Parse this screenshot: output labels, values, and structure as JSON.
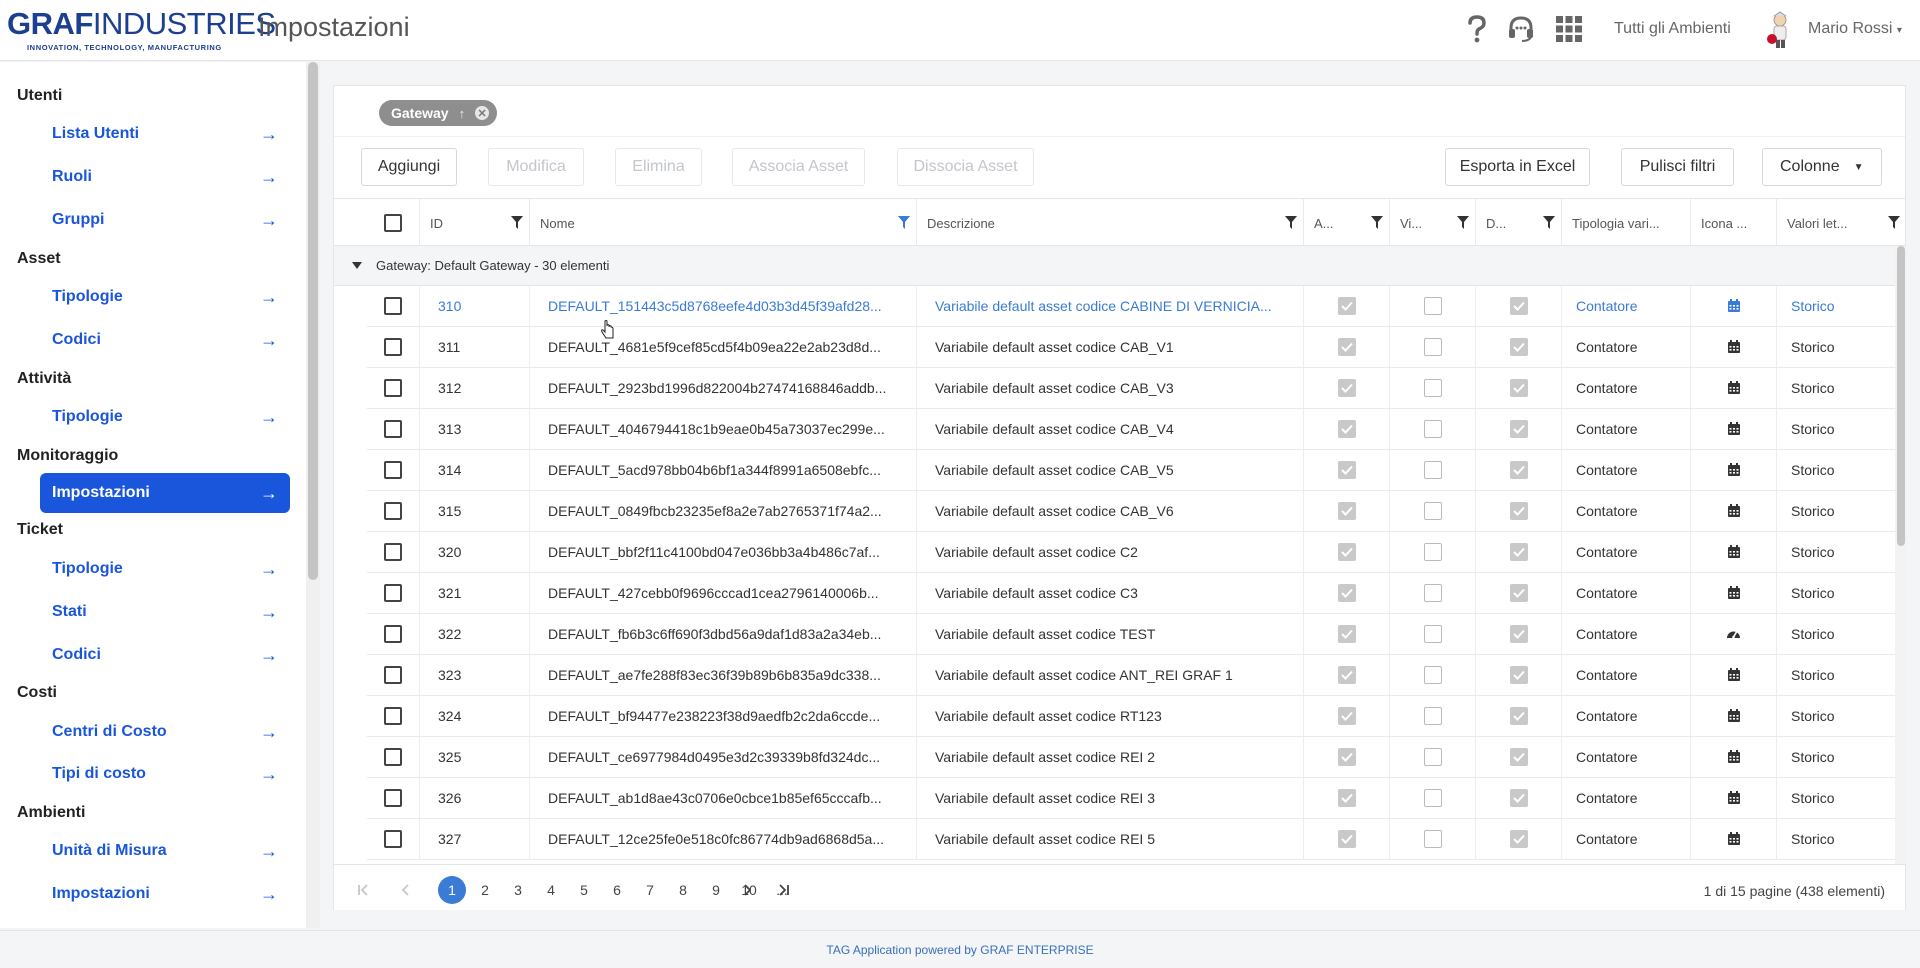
{
  "header": {
    "logo_text_bold": "GRAF",
    "logo_text_light": "INDUSTRIES",
    "logo_tagline": "INNOVATION, TECHNOLOGY, MANUFACTURING",
    "page_title": "Impostazioni",
    "help_icon": "help-icon",
    "support_icon": "headset-icon",
    "apps_icon": "grid-icon",
    "environments_label": "Tutti gli Ambienti",
    "user_name": "Mario Rossi"
  },
  "sidebar": {
    "sections": [
      {
        "title": "Utenti",
        "items": [
          "Lista Utenti",
          "Ruoli",
          "Gruppi"
        ]
      },
      {
        "title": "Asset",
        "items": [
          "Tipologie",
          "Codici"
        ]
      },
      {
        "title": "Attività",
        "items": [
          "Tipologie"
        ]
      },
      {
        "title": "Monitoraggio",
        "items": [
          "Impostazioni"
        ]
      },
      {
        "title": "Ticket",
        "items": [
          "Tipologie",
          "Stati",
          "Codici"
        ]
      },
      {
        "title": "Costi",
        "items": [
          "Centri di Costo",
          "Tipi di costo"
        ]
      },
      {
        "title": "Ambienti",
        "items": [
          "Unità di Misura",
          "Impostazioni"
        ]
      }
    ],
    "active_item": "Impostazioni"
  },
  "grid": {
    "group_chip": "Gateway",
    "toolbar": {
      "add": "Aggiungi",
      "edit": "Modifica",
      "delete": "Elimina",
      "assoc": "Associa Asset",
      "dissoc": "Dissocia Asset",
      "export": "Esporta in Excel",
      "clear_filters": "Pulisci filtri",
      "columns": "Colonne"
    },
    "columns": [
      "ID",
      "Nome",
      "Descrizione",
      "A...",
      "Vi...",
      "D...",
      "Tipologia vari...",
      "Icona ...",
      "Valori let..."
    ],
    "group_label": "Gateway: Default Gateway - 30 elementi",
    "rows": [
      {
        "id": "310",
        "nome": "DEFAULT_151443c5d8768eefe4d03b3d45f39afd28...",
        "descrizione": "Variabile default asset codice CABINE DI VERNICIA...",
        "a": true,
        "vi": false,
        "d": true,
        "tipologia": "Contatore",
        "icona": "calendar-icon",
        "valori": "Storico",
        "highlight": true
      },
      {
        "id": "311",
        "nome": "DEFAULT_4681e5f9cef85cd5f4b09ea22e2ab23d8d...",
        "descrizione": "Variabile default asset codice CAB_V1",
        "a": true,
        "vi": false,
        "d": true,
        "tipologia": "Contatore",
        "icona": "calendar-icon",
        "valori": "Storico"
      },
      {
        "id": "312",
        "nome": "DEFAULT_2923bd1996d822004b27474168846addb...",
        "descrizione": "Variabile default asset codice CAB_V3",
        "a": true,
        "vi": false,
        "d": true,
        "tipologia": "Contatore",
        "icona": "calendar-icon",
        "valori": "Storico"
      },
      {
        "id": "313",
        "nome": "DEFAULT_4046794418c1b9eae0b45a73037ec299e...",
        "descrizione": "Variabile default asset codice CAB_V4",
        "a": true,
        "vi": false,
        "d": true,
        "tipologia": "Contatore",
        "icona": "calendar-icon",
        "valori": "Storico"
      },
      {
        "id": "314",
        "nome": "DEFAULT_5acd978bb04b6bf1a344f8991a6508ebfc...",
        "descrizione": "Variabile default asset codice CAB_V5",
        "a": true,
        "vi": false,
        "d": true,
        "tipologia": "Contatore",
        "icona": "calendar-icon",
        "valori": "Storico"
      },
      {
        "id": "315",
        "nome": "DEFAULT_0849fbcb23235ef8a2e7ab2765371f74a2...",
        "descrizione": "Variabile default asset codice CAB_V6",
        "a": true,
        "vi": false,
        "d": true,
        "tipologia": "Contatore",
        "icona": "calendar-icon",
        "valori": "Storico"
      },
      {
        "id": "320",
        "nome": "DEFAULT_bbf2f11c4100bd047e036bb3a4b486c7af...",
        "descrizione": "Variabile default asset codice C2",
        "a": true,
        "vi": false,
        "d": true,
        "tipologia": "Contatore",
        "icona": "calendar-icon",
        "valori": "Storico"
      },
      {
        "id": "321",
        "nome": "DEFAULT_427cebb0f9696cccad1cea2796140006b...",
        "descrizione": "Variabile default asset codice C3",
        "a": true,
        "vi": false,
        "d": true,
        "tipologia": "Contatore",
        "icona": "calendar-icon",
        "valori": "Storico"
      },
      {
        "id": "322",
        "nome": "DEFAULT_fb6b3c6ff690f3dbd56a9daf1d83a2a34eb...",
        "descrizione": "Variabile default asset codice TEST",
        "a": true,
        "vi": false,
        "d": true,
        "tipologia": "Contatore",
        "icona": "gauge-icon",
        "valori": "Storico"
      },
      {
        "id": "323",
        "nome": "DEFAULT_ae7fe288f83ec36f39b89b6b835a9dc338...",
        "descrizione": "Variabile default asset codice ANT_REI GRAF 1",
        "a": true,
        "vi": false,
        "d": true,
        "tipologia": "Contatore",
        "icona": "calendar-icon",
        "valori": "Storico"
      },
      {
        "id": "324",
        "nome": "DEFAULT_bf94477e238223f38d9aedfb2c2da6ccde...",
        "descrizione": "Variabile default asset codice RT123",
        "a": true,
        "vi": false,
        "d": true,
        "tipologia": "Contatore",
        "icona": "calendar-icon",
        "valori": "Storico"
      },
      {
        "id": "325",
        "nome": "DEFAULT_ce6977984d0495e3d2c39339b8fd324dc...",
        "descrizione": "Variabile default asset codice REI 2",
        "a": true,
        "vi": false,
        "d": true,
        "tipologia": "Contatore",
        "icona": "calendar-icon",
        "valori": "Storico"
      },
      {
        "id": "326",
        "nome": "DEFAULT_ab1d8ae43c0706e0cbce1b85ef65cccafb...",
        "descrizione": "Variabile default asset codice REI 3",
        "a": true,
        "vi": false,
        "d": true,
        "tipologia": "Contatore",
        "icona": "calendar-icon",
        "valori": "Storico"
      },
      {
        "id": "327",
        "nome": "DEFAULT_12ce25fe0e518c0fc86774db9ad6868d5a...",
        "descrizione": "Variabile default asset codice REI 5",
        "a": true,
        "vi": false,
        "d": true,
        "tipologia": "Contatore",
        "icona": "calendar-icon",
        "valori": "Storico"
      }
    ],
    "pager": {
      "pages": [
        "1",
        "2",
        "3",
        "4",
        "5",
        "6",
        "7",
        "8",
        "9",
        "10",
        "..."
      ],
      "active_page": "1",
      "info": "1 di 15 pagine (438 elementi)"
    }
  },
  "footer": {
    "text": "TAG Application powered by GRAF ENTERPRISE"
  },
  "colors": {
    "accent": "#1a56db",
    "link": "#3a7bd5",
    "chip": "#8e8e8e"
  }
}
